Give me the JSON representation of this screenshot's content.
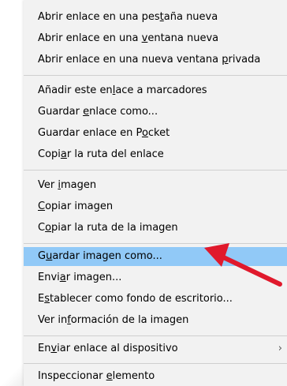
{
  "menu": {
    "items": [
      {
        "pre": "Abrir enlace en una pes",
        "acc": "t",
        "post": "aña nueva"
      },
      {
        "pre": "Abrir enlace en una ",
        "acc": "v",
        "post": "entana nueva"
      },
      {
        "pre": "Abrir enlace en una nueva ventana ",
        "acc": "p",
        "post": "rivada"
      },
      {
        "pre": "Añadir este en",
        "acc": "l",
        "post": "ace a marcadores"
      },
      {
        "pre": "Guardar ",
        "acc": "e",
        "post": "nlace como..."
      },
      {
        "pre": "Guardar enlace en P",
        "acc": "o",
        "post": "cket"
      },
      {
        "pre": "Copi",
        "acc": "a",
        "post": "r la ruta del enlace"
      },
      {
        "pre": "Ver ",
        "acc": "i",
        "post": "magen"
      },
      {
        "pre": "",
        "acc": "C",
        "post": "opiar imagen"
      },
      {
        "pre": "C",
        "acc": "o",
        "post": "piar la ruta de la imagen"
      },
      {
        "pre": "G",
        "acc": "u",
        "post": "ardar imagen como..."
      },
      {
        "pre": "Envi",
        "acc": "a",
        "post": "r imagen..."
      },
      {
        "pre": "E",
        "acc": "s",
        "post": "tablecer como fondo de escritorio..."
      },
      {
        "pre": "Ver in",
        "acc": "f",
        "post": "ormación de la imagen"
      },
      {
        "pre": "En",
        "acc": "v",
        "post": "iar enlace al dispositivo"
      },
      {
        "pre": "Inspeccionar ",
        "acc": "e",
        "post": "lemento"
      }
    ],
    "submenu_indicator": "›"
  },
  "colors": {
    "menu_background": "#f2f2f2",
    "selected_background": "#91c9f7",
    "separator": "#cfcfcf",
    "annotation_arrow": "#e0192c"
  },
  "icons": {
    "annotation": "red-arrow-icon",
    "submenu": "chevron-right-icon"
  }
}
